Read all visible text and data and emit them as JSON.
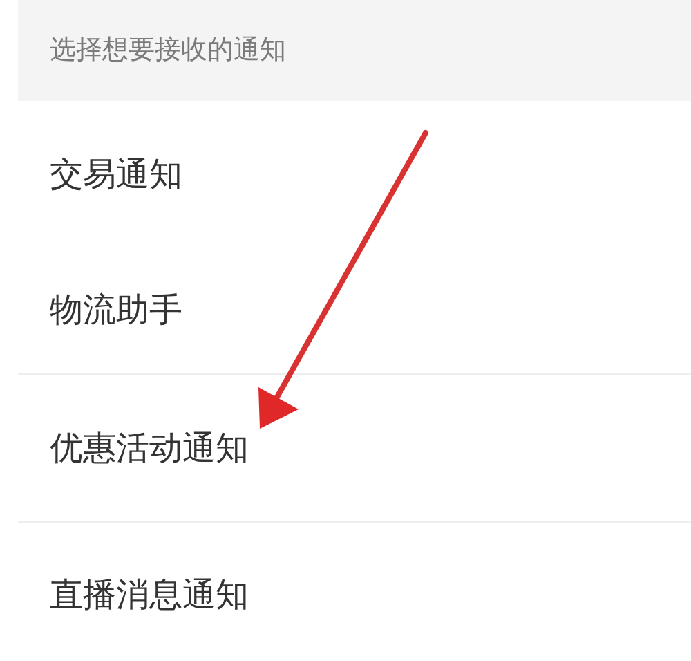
{
  "section_header": "选择想要接收的通知",
  "items": [
    {
      "label": "交易通知"
    },
    {
      "label": "物流助手"
    },
    {
      "label": "优惠活动通知"
    },
    {
      "label": "直播消息通知"
    }
  ]
}
